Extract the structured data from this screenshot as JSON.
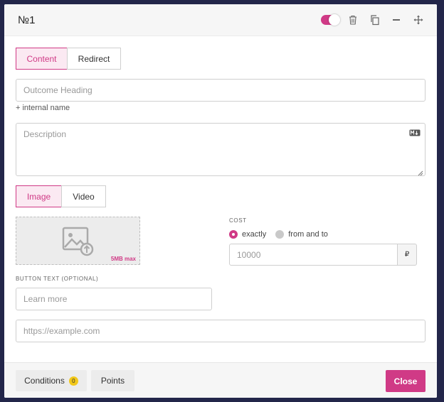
{
  "header": {
    "title": "№1",
    "toggle_on": true,
    "icons": [
      "trash-icon",
      "copy-icon",
      "minus-icon",
      "move-icon"
    ]
  },
  "content_tabs": {
    "content": "Content",
    "redirect": "Redirect",
    "active": "Content"
  },
  "heading_field": {
    "placeholder": "Outcome Heading",
    "value": ""
  },
  "internal_name_link": "+ internal name",
  "description_field": {
    "placeholder": "Description",
    "value": ""
  },
  "media_tabs": {
    "image": "Image",
    "video": "Video",
    "active": "Image"
  },
  "uploader": {
    "limit_label": "5MB max"
  },
  "cost": {
    "label": "COST",
    "options": [
      "exactly",
      "from and to"
    ],
    "selected": "exactly",
    "placeholder": "10000",
    "currency": "₽"
  },
  "button_text": {
    "label": "BUTTON TEXT (OPTIONAL)",
    "placeholder": "Learn more"
  },
  "url_field": {
    "placeholder": "https://example.com"
  },
  "footer": {
    "conditions_label": "Conditions",
    "conditions_count": "0",
    "points_label": "Points",
    "close_label": "Close"
  },
  "colors": {
    "accent": "#d03a86",
    "badge": "#f2c81a",
    "background": "#23264a"
  }
}
